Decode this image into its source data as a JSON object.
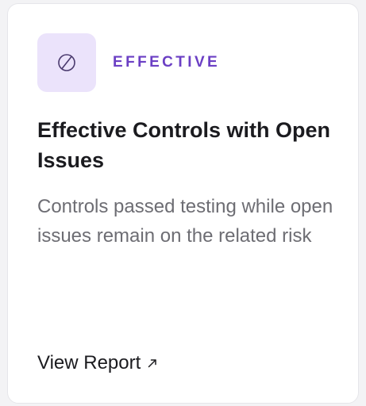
{
  "card": {
    "badge": {
      "icon": "circle-slash-icon",
      "label": "EFFECTIVE"
    },
    "title": "Effective Controls with Open Issues",
    "description": "Controls passed testing while open issues remain on the related risk",
    "link": {
      "label": "View Report",
      "icon": "arrow-up-right-icon"
    }
  },
  "colors": {
    "accent": "#6b3fc4",
    "badge_background": "#ebe3fb",
    "title": "#1b1b1f",
    "description": "#6d6d73",
    "card_background": "#ffffff",
    "page_background": "#f3f3f5"
  }
}
